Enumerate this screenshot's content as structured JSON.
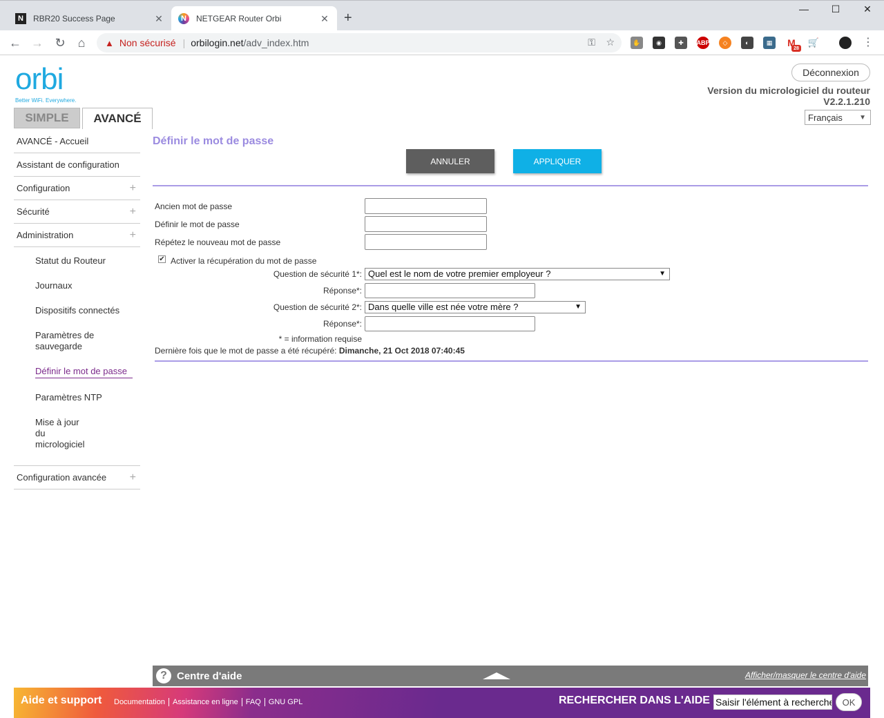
{
  "browser": {
    "tabs": [
      {
        "title": "RBR20 Success Page",
        "favicon": "N"
      },
      {
        "title": "NETGEAR Router Orbi",
        "favicon": "N"
      }
    ],
    "security_label": "Non sécurisé",
    "url_domain": "orbilogin.net",
    "url_path": "/adv_index.htm",
    "ext_badge": "28",
    "ext_abp": "ABP"
  },
  "header": {
    "logo_word": "orbi",
    "logo_tagline": "Better WiFi. Everywhere.",
    "logout_label": "Déconnexion",
    "firmware_label": "Version du micrologiciel du routeur",
    "firmware_version": "V2.2.1.210",
    "language": "Français"
  },
  "mode_tabs": {
    "simple": "SIMPLE",
    "advanced": "AVANCÉ"
  },
  "sidebar": {
    "items": [
      {
        "label": "AVANCÉ - Accueil"
      },
      {
        "label": "Assistant de configuration"
      },
      {
        "label": "Configuration"
      },
      {
        "label": "Sécurité"
      },
      {
        "label": "Administration"
      }
    ],
    "sub_items": [
      {
        "label": "Statut du Routeur"
      },
      {
        "label": "Journaux"
      },
      {
        "label": "Dispositifs connectés"
      },
      {
        "label": "Paramètres de sauvegarde"
      },
      {
        "label": "Définir le mot de passe"
      },
      {
        "label": "Paramètres NTP"
      },
      {
        "label": "Mise à jour du micrologiciel"
      }
    ],
    "advanced_config": "Configuration avancée"
  },
  "main": {
    "heading": "Définir le mot de passe",
    "cancel_label": "ANNULER",
    "apply_label": "APPLIQUER",
    "old_password_label": "Ancien mot de passe",
    "new_password_label": "Définir le mot de passe",
    "repeat_password_label": "Répétez le nouveau mot de passe",
    "recovery_label": "Activer la récupération du mot de passe",
    "question1_label": "Question de sécurité 1*:",
    "question1_value": "Quel est le nom de votre premier employeur ?",
    "answer1_label": "Réponse*:",
    "question2_label": "Question de sécurité 2*:",
    "question2_value": "Dans quelle ville est née votre mère ?",
    "answer2_label": "Réponse*:",
    "required_note": "* = information requise",
    "last_recovered_label": "Dernière fois que le mot de passe a été récupéré:",
    "last_recovered_value": "Dimanche, 21 Oct 2018 07:40:45"
  },
  "helpbar": {
    "title": "Centre d'aide",
    "toggle_label": "Afficher/masquer le centre d'aide"
  },
  "footer": {
    "title": "Aide et support",
    "links": [
      "Documentation",
      "Assistance en ligne",
      "FAQ",
      "GNU GPL"
    ],
    "search_label": "RECHERCHER DANS L'AIDE",
    "search_value": "Saisir l'élément à rechercher",
    "ok_label": "OK"
  }
}
